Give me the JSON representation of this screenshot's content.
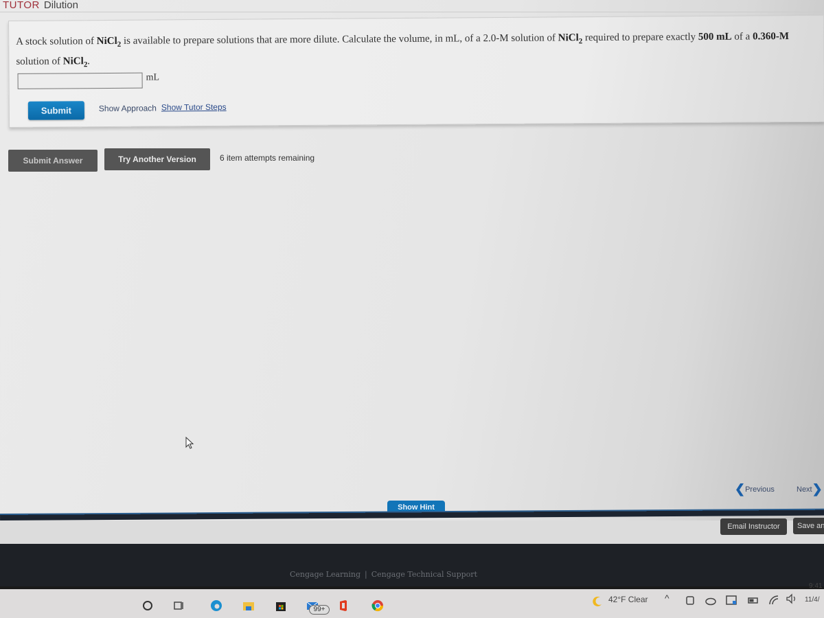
{
  "header": {
    "tutor_label": "TUTOR",
    "topic": "Dilution"
  },
  "question": {
    "part1": "A stock solution of ",
    "compound_base": "NiCl",
    "compound_sub": "2",
    "part2": " is available to prepare solutions that are more dilute. Calculate the volume, in mL, of a 2.0-M solution of ",
    "part3": " required to prepare exactly ",
    "volume": "500 mL",
    "part4": " of a ",
    "concentration": "0.360-M",
    "part5": " solution of ",
    "part6": "."
  },
  "answer": {
    "value": "",
    "placeholder": "",
    "unit": "mL"
  },
  "actions": {
    "submit": "Submit",
    "show_approach": "Show Approach",
    "show_tutor_steps": "Show Tutor Steps",
    "submit_answer": "Submit Answer",
    "try_another_version": "Try Another Version",
    "attempts_remaining": "6 item attempts remaining"
  },
  "navigation": {
    "previous": "Previous",
    "next": "Next",
    "show_hint": "Show Hint",
    "email_instructor": "Email Instructor",
    "save_and": "Save an"
  },
  "footer": {
    "cengage_learning": "Cengage Learning",
    "separator": "|",
    "technical_support": "Cengage Technical Support"
  },
  "taskbar": {
    "mail_badge": "99+",
    "weather": "42°F  Clear",
    "time": "9:41",
    "date": "11/4/"
  },
  "colors": {
    "accent_blue": "#1275b8",
    "tutor_red": "#a0303a",
    "gray_button": "#555555"
  }
}
